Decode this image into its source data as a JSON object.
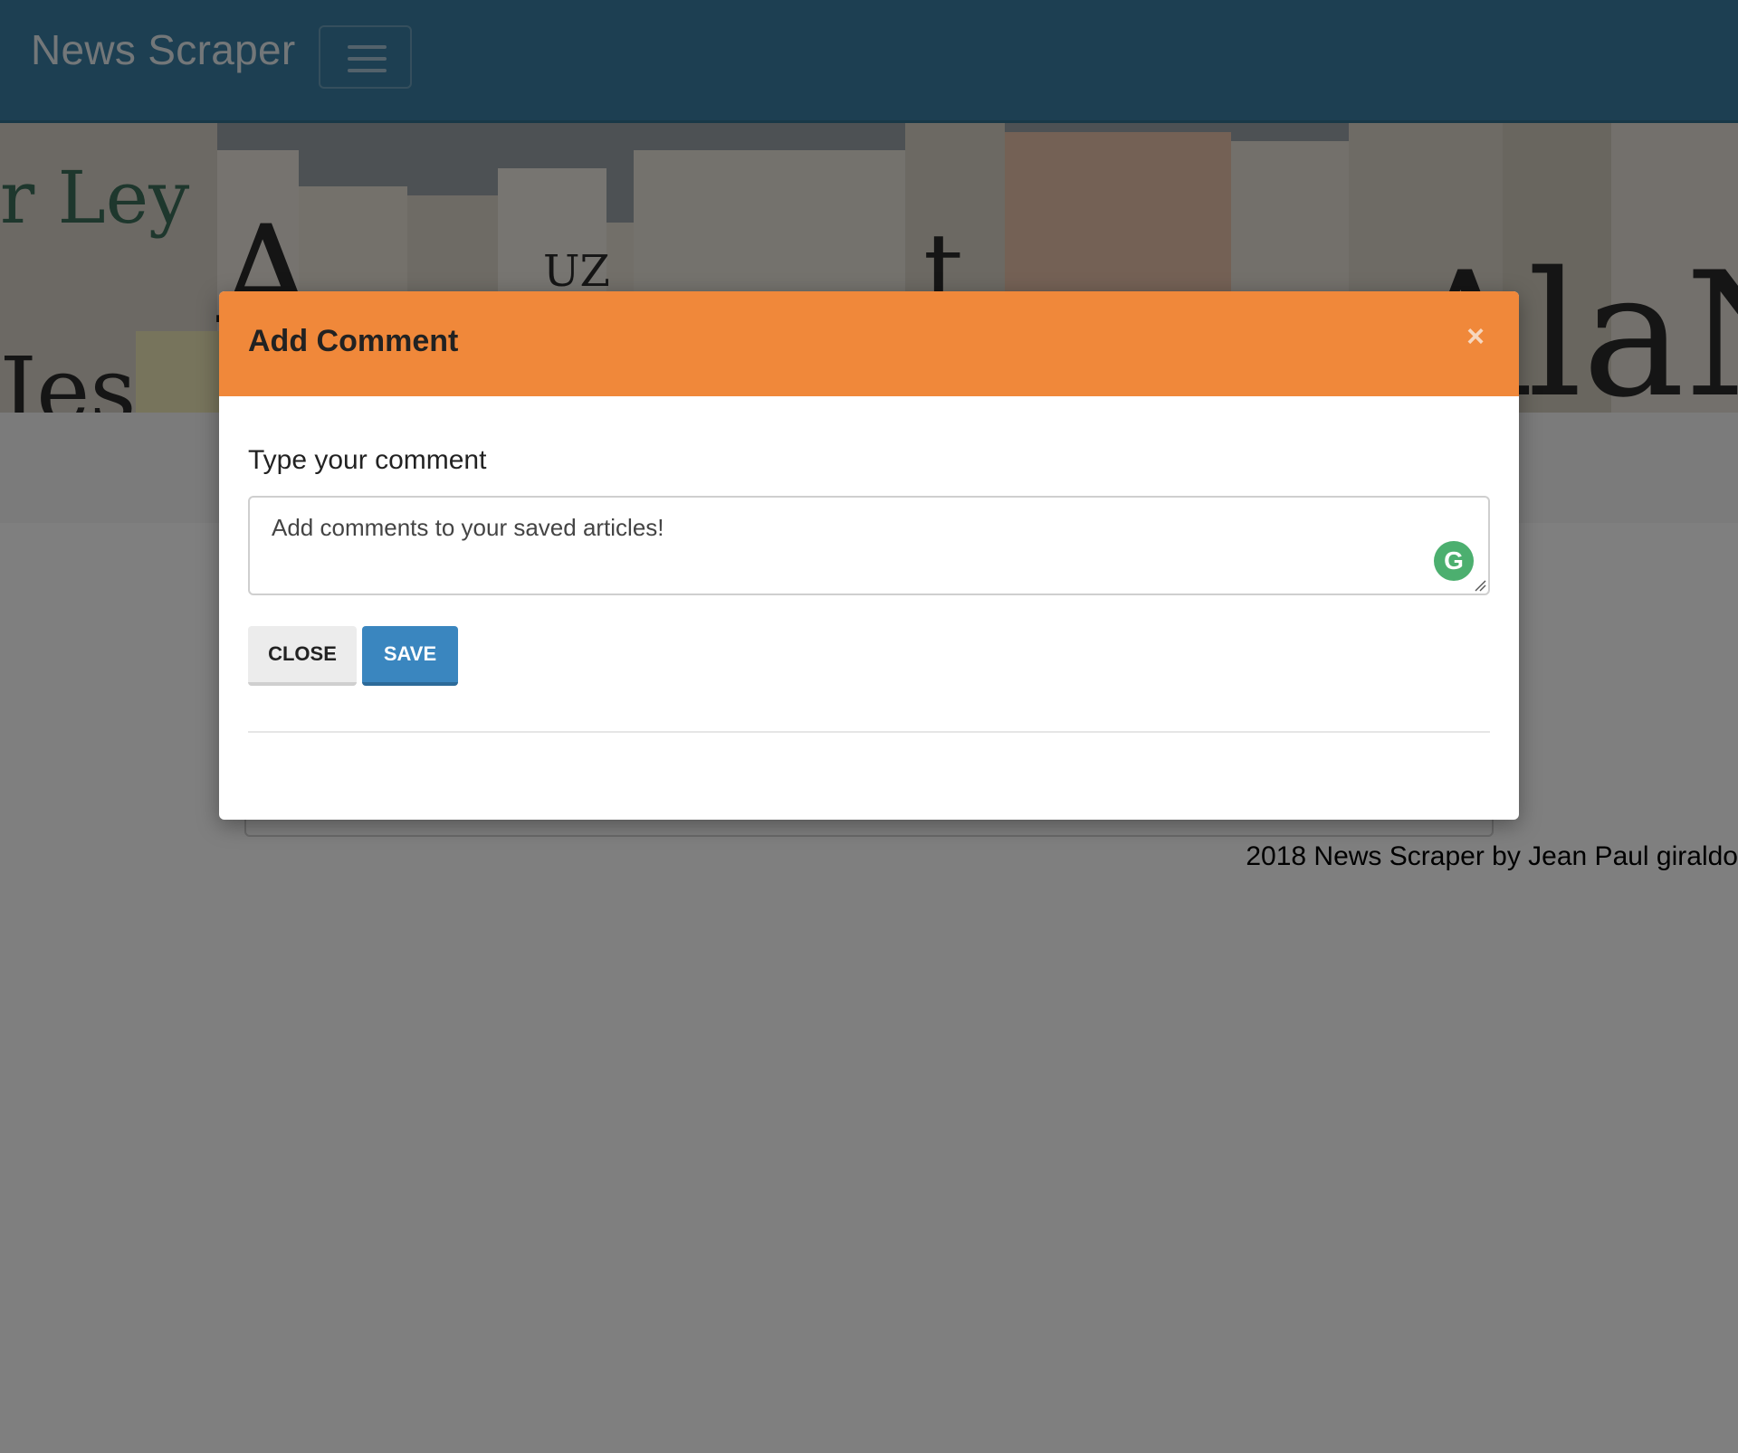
{
  "navbar": {
    "brand": "News Scraper",
    "toggler_icon": "hamburger-menu-icon"
  },
  "hero": {
    "image": "newspapers-stack-image"
  },
  "footer": {
    "text": "2018 News Scraper by Jean Paul giraldo"
  },
  "modal": {
    "title": "Add Comment",
    "close_icon": "close-x-icon",
    "close_glyph": "×",
    "field_label": "Type your comment",
    "textarea_value": "Add comments to your saved articles!",
    "grammarly_icon": "grammarly-icon",
    "grammarly_glyph": "G",
    "buttons": {
      "close_label": "Close",
      "save_label": "Save"
    }
  },
  "colors": {
    "navbar": "#3a7fa5",
    "modal_header": "#f0883a",
    "save_button": "#3a86bf",
    "grammarly": "#4caf6f"
  }
}
